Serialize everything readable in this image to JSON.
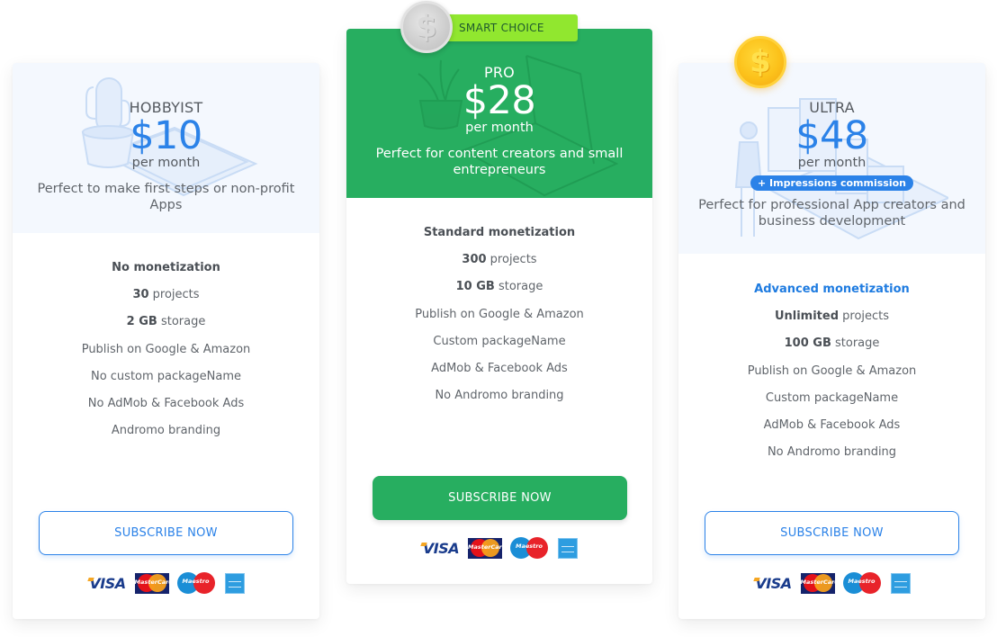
{
  "badge": {
    "smart_choice": "SMART CHOICE"
  },
  "colors": {
    "brand_blue": "#2b82e8",
    "brand_green": "#27ae60",
    "badge_lime": "#91e72f",
    "card_head_bg": "#f4f8fe"
  },
  "plans": [
    {
      "name": "HOBBYIST",
      "price": "$10",
      "period": "per month",
      "description": "Perfect to make first steps or non-profit Apps",
      "illustration": "cactus-and-phone",
      "features": [
        {
          "bold": "",
          "text": "No monetization",
          "lead": true
        },
        {
          "bold": "30",
          "text": " projects"
        },
        {
          "bold": "2 GB",
          "text": " storage"
        },
        {
          "bold": "",
          "text": "Publish on Google & Amazon"
        },
        {
          "bold": "",
          "text": "No custom packageName"
        },
        {
          "bold": "",
          "text": "No AdMob & Facebook Ads"
        },
        {
          "bold": "",
          "text": "Andromo branding"
        }
      ],
      "cta": "SUBSCRIBE NOW",
      "payments": [
        "VISA",
        "MasterCard",
        "Maestro",
        "American Express"
      ]
    },
    {
      "name": "PRO",
      "price": "$28",
      "period": "per month",
      "description": "Perfect for content creators and small entrepreneurs",
      "illustration": "plant-and-laptop",
      "coin": "silver-coin",
      "features": [
        {
          "bold": "",
          "text": "Standard monetization",
          "lead": true
        },
        {
          "bold": "300",
          "text": " projects"
        },
        {
          "bold": "10 GB",
          "text": " storage"
        },
        {
          "bold": "",
          "text": "Publish on Google & Amazon"
        },
        {
          "bold": "",
          "text": "Custom packageName"
        },
        {
          "bold": "",
          "text": "AdMob & Facebook Ads"
        },
        {
          "bold": "",
          "text": "No Andromo branding"
        }
      ],
      "cta": "SUBSCRIBE NOW",
      "payments": [
        "VISA",
        "MasterCard",
        "Maestro",
        "American Express"
      ]
    },
    {
      "name": "ULTRA",
      "price": "$48",
      "period": "per month",
      "commission_badge": "+ Impressions commission",
      "description": "Perfect for professional App creators and business development",
      "illustration": "person-and-servers",
      "coin": "gold-coin",
      "features": [
        {
          "bold": "",
          "text": "Advanced monetization",
          "lead": true,
          "accent": true
        },
        {
          "bold": "Unlimited",
          "text": " projects"
        },
        {
          "bold": "100 GB",
          "text": " storage"
        },
        {
          "bold": "",
          "text": "Publish on Google & Amazon"
        },
        {
          "bold": "",
          "text": "Custom packageName"
        },
        {
          "bold": "",
          "text": "AdMob & Facebook Ads"
        },
        {
          "bold": "",
          "text": "No Andromo branding"
        }
      ],
      "cta": "SUBSCRIBE NOW",
      "payments": [
        "VISA",
        "MasterCard",
        "Maestro",
        "American Express"
      ]
    }
  ],
  "payment_labels": {
    "visa": "VISA",
    "mastercard": "MasterCard",
    "maestro": "Maestro"
  }
}
